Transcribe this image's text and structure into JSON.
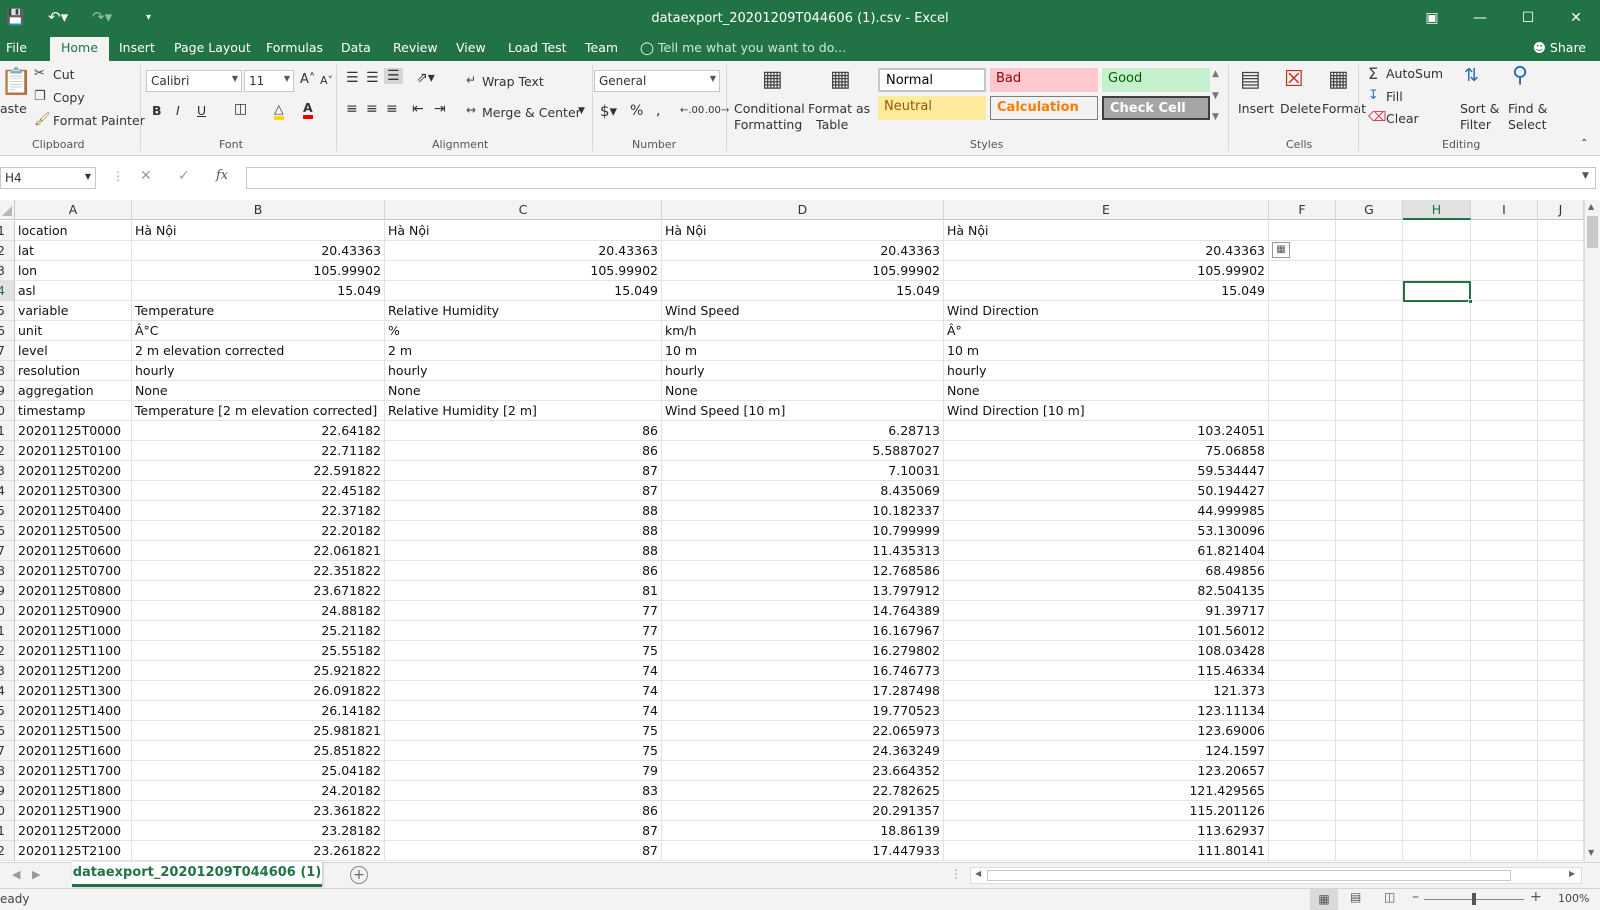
{
  "window": {
    "title": "dataexport_20201209T044606 (1).csv - Excel",
    "share_label": "Share",
    "tell_me": "Tell me what you want to do..."
  },
  "tabs": [
    "File",
    "Home",
    "Insert",
    "Page Layout",
    "Formulas",
    "Data",
    "Review",
    "View",
    "Load Test",
    "Team"
  ],
  "ribbon": {
    "clipboard": {
      "paste": "Paste",
      "cut": "Cut",
      "copy": "Copy",
      "format_painter": "Format Painter",
      "group": "Clipboard"
    },
    "font": {
      "name": "Calibri",
      "size": "11",
      "group": "Font"
    },
    "alignment": {
      "wrap": "Wrap Text",
      "merge": "Merge & Center",
      "group": "Alignment"
    },
    "number": {
      "format": "General",
      "group": "Number"
    },
    "styles": {
      "cond1": "Conditional",
      "cond2": "Formatting",
      "fmt1": "Format as",
      "fmt2": "Table",
      "normal": "Normal",
      "bad": "Bad",
      "good": "Good",
      "neutral": "Neutral",
      "calculation": "Calculation",
      "check": "Check Cell",
      "group": "Styles"
    },
    "cells": {
      "insert": "Insert",
      "delete": "Delete",
      "format": "Format",
      "group": "Cells"
    },
    "editing": {
      "autosum": "AutoSum",
      "fill": "Fill",
      "clear": "Clear",
      "sort1": "Sort &",
      "sort2": "Filter",
      "find1": "Find &",
      "find2": "Select",
      "group": "Editing"
    }
  },
  "formula_bar": {
    "name_box": "H4",
    "fx": "fx",
    "value": ""
  },
  "grid": {
    "columns": [
      "A",
      "B",
      "C",
      "D",
      "E",
      "F",
      "G",
      "H",
      "I",
      "J"
    ],
    "selected_col": "H",
    "selected_row": "4",
    "row_numbers": [
      "1",
      "2",
      "3",
      "4",
      "5",
      "6",
      "7",
      "8",
      "9",
      "0",
      "1",
      "2",
      "3",
      "4",
      "5",
      "6",
      "7",
      "8",
      "9",
      "0",
      "1",
      "2",
      "3",
      "4",
      "5",
      "6",
      "7",
      "8",
      "9",
      "0",
      "1",
      "2"
    ],
    "rows": [
      [
        "location",
        "Hà Nội",
        "Hà Nội",
        "Hà Nội",
        "Hà Nội"
      ],
      [
        "lat",
        "20.43363",
        "20.43363",
        "20.43363",
        "20.43363"
      ],
      [
        "lon",
        "105.99902",
        "105.99902",
        "105.99902",
        "105.99902"
      ],
      [
        "asl",
        "15.049",
        "15.049",
        "15.049",
        "15.049"
      ],
      [
        "variable",
        "Temperature",
        "Relative Humidity",
        "Wind Speed",
        "Wind Direction"
      ],
      [
        "unit",
        "Â°C",
        "%",
        "km/h",
        "Â°"
      ],
      [
        "level",
        "2 m elevation corrected",
        "2 m",
        "10 m",
        "10 m"
      ],
      [
        "resolution",
        "hourly",
        "hourly",
        "hourly",
        "hourly"
      ],
      [
        "aggregation",
        "None",
        "None",
        "None",
        "None"
      ],
      [
        "timestamp",
        "Temperature [2 m elevation corrected]",
        "Relative Humidity [2 m]",
        "Wind Speed [10 m]",
        "Wind Direction [10 m]"
      ],
      [
        "20201125T0000",
        "22.64182",
        "86",
        "6.28713",
        "103.24051"
      ],
      [
        "20201125T0100",
        "22.71182",
        "86",
        "5.5887027",
        "75.06858"
      ],
      [
        "20201125T0200",
        "22.591822",
        "87",
        "7.10031",
        "59.534447"
      ],
      [
        "20201125T0300",
        "22.45182",
        "87",
        "8.435069",
        "50.194427"
      ],
      [
        "20201125T0400",
        "22.37182",
        "88",
        "10.182337",
        "44.999985"
      ],
      [
        "20201125T0500",
        "22.20182",
        "88",
        "10.799999",
        "53.130096"
      ],
      [
        "20201125T0600",
        "22.061821",
        "88",
        "11.435313",
        "61.821404"
      ],
      [
        "20201125T0700",
        "22.351822",
        "86",
        "12.768586",
        "68.49856"
      ],
      [
        "20201125T0800",
        "23.671822",
        "81",
        "13.797912",
        "82.504135"
      ],
      [
        "20201125T0900",
        "24.88182",
        "77",
        "14.764389",
        "91.39717"
      ],
      [
        "20201125T1000",
        "25.21182",
        "77",
        "16.167967",
        "101.56012"
      ],
      [
        "20201125T1100",
        "25.55182",
        "75",
        "16.279802",
        "108.03428"
      ],
      [
        "20201125T1200",
        "25.921822",
        "74",
        "16.746773",
        "115.46334"
      ],
      [
        "20201125T1300",
        "26.091822",
        "74",
        "17.287498",
        "121.373"
      ],
      [
        "20201125T1400",
        "26.14182",
        "74",
        "19.770523",
        "123.11134"
      ],
      [
        "20201125T1500",
        "25.981821",
        "75",
        "22.065973",
        "123.69006"
      ],
      [
        "20201125T1600",
        "25.851822",
        "75",
        "24.363249",
        "124.1597"
      ],
      [
        "20201125T1700",
        "25.04182",
        "79",
        "23.664352",
        "123.20657"
      ],
      [
        "20201125T1800",
        "24.20182",
        "83",
        "22.782625",
        "121.429565"
      ],
      [
        "20201125T1900",
        "23.361822",
        "86",
        "20.291357",
        "115.201126"
      ],
      [
        "20201125T2000",
        "23.28182",
        "87",
        "18.86139",
        "113.62937"
      ],
      [
        "20201125T2100",
        "23.261822",
        "87",
        "17.447933",
        "111.80141"
      ]
    ]
  },
  "sheet_tab": "dataexport_20201209T044606 (1)",
  "status": {
    "ready": "eady",
    "zoom": "100%"
  },
  "colors": {
    "brand": "#217346"
  }
}
